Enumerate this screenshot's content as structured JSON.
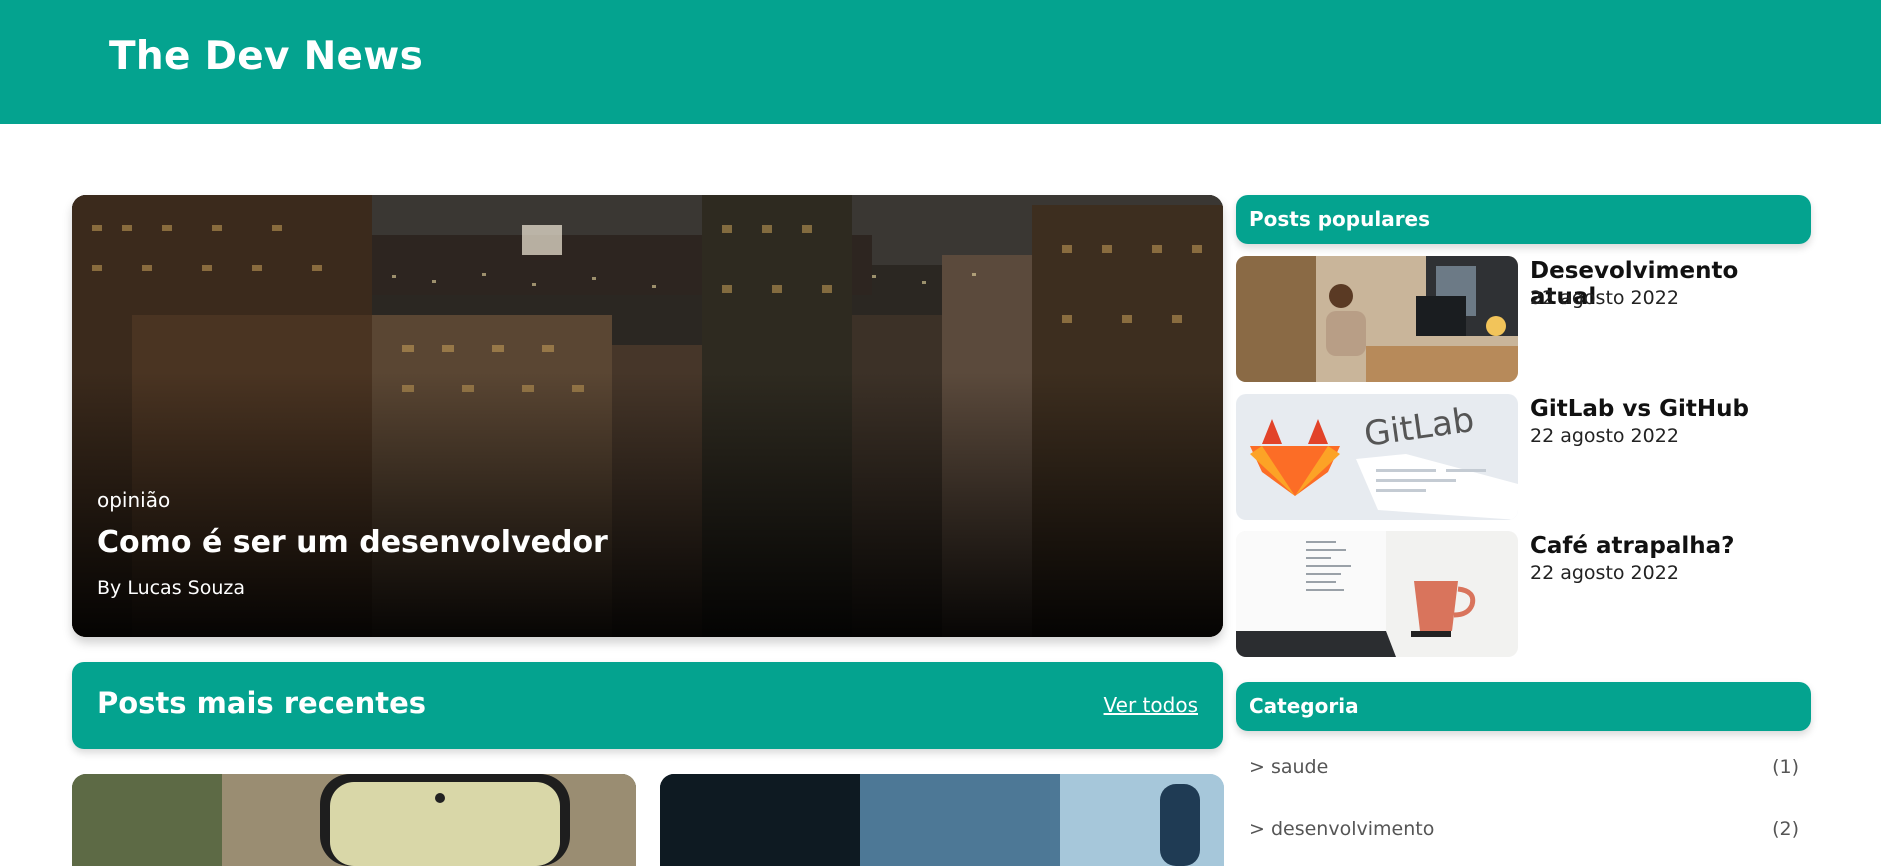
{
  "header": {
    "brand": "The Dev News"
  },
  "hero": {
    "category": "opinião",
    "title": "Como é ser um desenvolvedor",
    "author": "By Lucas Souza"
  },
  "recent": {
    "title": "Posts mais recentes",
    "view_all": "Ver todos"
  },
  "popular": {
    "title": "Posts populares",
    "items": [
      {
        "title": "Desevolvimento atual",
        "date": "22 agosto 2022"
      },
      {
        "title": "GitLab vs GitHub",
        "date": "22 agosto 2022"
      },
      {
        "title": "Café atrapalha?",
        "date": "22 agosto 2022"
      }
    ],
    "gitlab_logo_text": "GitLab"
  },
  "categories": {
    "title": "Categoria",
    "items": [
      {
        "name": "> saude",
        "count": "(1)"
      },
      {
        "name": "> desenvolvimento",
        "count": "(2)"
      }
    ]
  },
  "colors": {
    "accent": "#04a38f"
  }
}
